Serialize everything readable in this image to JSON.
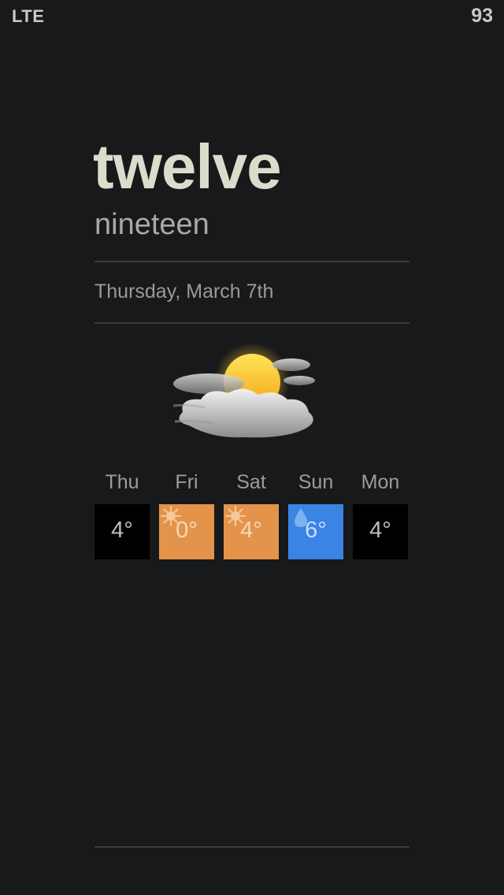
{
  "status_bar": {
    "carrier": "LTE",
    "battery": "93"
  },
  "clock": {
    "hour": "twelve",
    "minute": "nineteen"
  },
  "date": "Thursday, March 7th",
  "current_weather": {
    "icon": "partly-cloudy-icon"
  },
  "forecast": [
    {
      "day": "Thu",
      "temp": "4°",
      "icon": "none",
      "tile_color": "#000000",
      "text_color": "#bdbdbd"
    },
    {
      "day": "Fri",
      "temp": "0°",
      "icon": "sun-icon",
      "tile_color": "#e3944a",
      "text_color": "#f6d8b5"
    },
    {
      "day": "Sat",
      "temp": "4°",
      "icon": "sun-icon",
      "tile_color": "#e3944a",
      "text_color": "#f6d8b5"
    },
    {
      "day": "Sun",
      "temp": "6°",
      "icon": "raindrop-icon",
      "tile_color": "#3a84e6",
      "text_color": "#c9defa"
    },
    {
      "day": "Mon",
      "temp": "4°",
      "icon": "none",
      "tile_color": "#000000",
      "text_color": "#bdbdbd"
    }
  ],
  "colors": {
    "background": "#18191b",
    "hour_text": "#dbdccc",
    "divider": "#3a3b3d"
  }
}
